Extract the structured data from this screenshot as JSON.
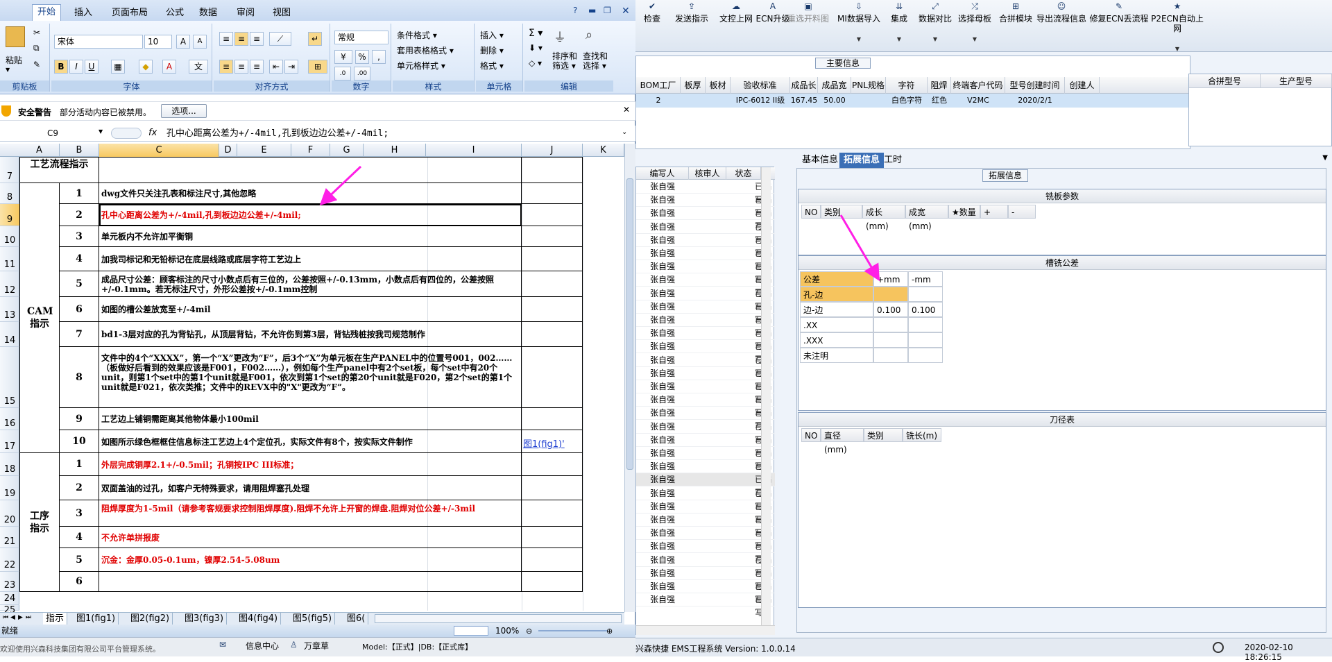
{
  "erp": {
    "toolbar": [
      {
        "label": "检查",
        "icon": "check-icon",
        "dd": false
      },
      {
        "label": "发送指示",
        "icon": "send-icon",
        "dd": false
      },
      {
        "label": "文控上网",
        "icon": "upload-icon",
        "dd": false
      },
      {
        "label": "ECN升级",
        "icon": "upgrade-icon",
        "dd": false
      },
      {
        "label": "重选开料图",
        "icon": "image-icon",
        "dd": false,
        "disabled": true
      },
      {
        "label": "MI数据导入",
        "icon": "import-icon",
        "dd": true
      },
      {
        "label": "集成",
        "icon": "integrate-icon",
        "dd": true
      },
      {
        "label": "数据对比",
        "icon": "compare-icon",
        "dd": true
      },
      {
        "label": "选择母板",
        "icon": "select-board-icon",
        "dd": true
      },
      {
        "label": "合拼模块",
        "icon": "merge-icon",
        "dd": false
      },
      {
        "label": "导出流程信息",
        "icon": "export-icon",
        "dd": false
      },
      {
        "label": "修复ECN丢流程",
        "icon": "repair-icon",
        "dd": false
      },
      {
        "label": "P2ECN自动上网",
        "icon": "star-icon",
        "dd": true
      }
    ],
    "main_info_title": "主要信息",
    "main_headers": [
      "BOM工厂",
      "板厚",
      "板材",
      "验收标准",
      "成品长度",
      "成品宽度",
      "PNL规格",
      "字符",
      "阻焊",
      "终端客户代码",
      "型号创建时间",
      "创建人"
    ],
    "main_row": [
      "2",
      "",
      "",
      "IPC-6012 II级",
      "167.45",
      "50.00",
      "",
      "白色字符",
      "红色",
      "V2MC",
      "2020/2/1",
      ""
    ],
    "side_headers": [
      "合拼型号",
      "生产型号"
    ],
    "list_headers": [
      "编写人",
      "核审人",
      "状态"
    ],
    "list_name": "张自强",
    "list_status": "已编写",
    "list_count": 32,
    "list_selected_index": 22,
    "detail_tabs": [
      "基本信息",
      "拓展信息",
      "工时"
    ],
    "ext_title": "拓展信息",
    "mill_title": "铣板参数",
    "mill_headers": [
      "NO",
      "类别",
      "成长(mm)",
      "成宽(mm)",
      "★数量",
      "+",
      "-"
    ],
    "slot_title": "槽铣公差",
    "slot_headers": [
      "公差",
      "+mm",
      "-mm"
    ],
    "slot_rows": [
      {
        "label": "孔-边",
        "plus": "",
        "minus": ""
      },
      {
        "label": "边-边",
        "plus": "0.100",
        "minus": "0.100"
      },
      {
        "label": ".XX",
        "plus": "",
        "minus": ""
      },
      {
        "label": ".XXX",
        "plus": "",
        "minus": ""
      },
      {
        "label": "未注明",
        "plus": "",
        "minus": ""
      }
    ],
    "tool_title": "刀径表",
    "tool_headers": [
      "NO",
      "直径(mm)",
      "类别",
      "铣长(m)"
    ],
    "status_left": "兴森快捷 EMS工程系统 Version: 1.0.0.14",
    "status_time": "2020-02-10 18:26:15"
  },
  "excel": {
    "tabs": [
      "开始",
      "插入",
      "页面布局",
      "公式",
      "数据",
      "审阅",
      "视图"
    ],
    "ribbon": {
      "paste": "粘贴",
      "clipboard": "剪贴板",
      "font_name": "宋体",
      "font_size": "10",
      "font": "字体",
      "align": "对齐方式",
      "number_format": "常规",
      "number": "数字",
      "cond_format": "条件格式",
      "table_format": "套用表格格式",
      "cell_style": "单元格样式",
      "styles": "样式",
      "insert": "插入",
      "delete": "删除",
      "format": "格式",
      "cells": "单元格",
      "sort": "排序和",
      "filter": "筛选",
      "find": "查找和",
      "select": "选择",
      "edit": "编辑"
    },
    "security_title": "安全警告",
    "security_msg": "部分活动内容已被禁用。",
    "security_btn": "选项...",
    "name_box": "C9",
    "formula": "孔中心距离公差为+/-4mil,孔到板边边公差+/-4mil;",
    "columns": [
      "A",
      "B",
      "C",
      "D",
      "E",
      "F",
      "G",
      "H",
      "I",
      "J",
      "K"
    ],
    "row_numbers": [
      "7",
      "8",
      "9",
      "10",
      "11",
      "12",
      "13",
      "14",
      "15",
      "16",
      "17",
      "18",
      "19",
      "20",
      "21",
      "22",
      "23",
      "24",
      "25"
    ],
    "header_cell": "工艺流程指示",
    "group1": "CAM指示",
    "group2": "工序指示",
    "cam_items": [
      {
        "no": "1",
        "text": "dwg文件只关注孔表和标注尺寸,其他忽略",
        "red": false
      },
      {
        "no": "2",
        "text": "孔中心距离公差为+/-4mil,孔到板边边公差+/-4mil;",
        "red": true
      },
      {
        "no": "3",
        "text": "单元板内不允许加平衡铜",
        "red": false
      },
      {
        "no": "4",
        "text": "加我司标记和无铅标记在底层线路或底层字符工艺边上",
        "red": false
      },
      {
        "no": "5",
        "text": "成品尺寸公差：顾客标注的尺寸小数点后有三位的，公差按照+/-0.13mm，小数点后有四位的，公差按照+/-0.1mm。若无标注尺寸，外形公差按+/-0.1mm控制",
        "red": false
      },
      {
        "no": "6",
        "text": "如图的槽公差放宽至+/-4mil",
        "red": false
      },
      {
        "no": "7",
        "text": "bd1-3层对应的孔为背钻孔，从顶层背钻，不允许伤到第3层，背钻残桩按我司规范制作",
        "red": false
      },
      {
        "no": "8",
        "text": "文件中的4个“XXXX”，第一个“X”更改为“F”，后3个“X”为单元板在生产PANEL中的位置号001，002……（板做好后看到的效果应该是F001，F002……），例如每个生产panel中有2个set板，每个set中有20个unit，则第1个set中的第1个unit就是F001，依次到第1个set的第20个unit就是F020，第2个set的第1个unit就是F021，依次类推；文件中的REVX中的\"X\"更改为“F”。",
        "red": false
      },
      {
        "no": "9",
        "text": "工艺边上铺铜需距离其他物体最小100mil",
        "red": false
      },
      {
        "no": "10",
        "text": "如图所示绿色框框住信息标注工艺边上4个定位孔，实际文件有8个，按实际文件制作",
        "red": false,
        "link": "图1(fig1)'"
      }
    ],
    "proc_items": [
      {
        "no": "1",
        "text": "外层完成铜厚2.1+/-0.5mil；孔铜按IPC III标准；",
        "red": true
      },
      {
        "no": "2",
        "text": "双面盖油的过孔，如客户无特殊要求，请用阻焊塞孔处理",
        "red": false
      },
      {
        "no": "3",
        "text": "阻焊厚度为1-5mil（请参考客规要求控制阻焊厚度).阻焊不允许上开窗的焊盘.阻焊对位公差+/-3mil",
        "red": true
      },
      {
        "no": "4",
        "text": "不允许单拼报废",
        "red": true
      },
      {
        "no": "5",
        "text": "沉金：金厚0.05-0.1um，镍厚2.54-5.08um",
        "red": true
      },
      {
        "no": "6",
        "text": "",
        "red": false
      }
    ],
    "sheet_tabs": [
      "指示",
      "图1(fig1)",
      "图2(fig2)",
      "图3(fig3)",
      "图4(fig4)",
      "图5(fig5)",
      "图6("
    ],
    "status_ready": "就绪",
    "zoom": "100%"
  },
  "taskbar": {
    "left": "欢迎使用兴森科技集团有限公司平台管理系统。",
    "item1": "信息中心",
    "item2": "万章草",
    "model": "Model:【正式】|DB:【正式库】"
  },
  "colors": {
    "accent": "#3b6fb6",
    "red": "#e00000",
    "arrow": "#ff1fe6",
    "link": "#1f3fd1"
  }
}
